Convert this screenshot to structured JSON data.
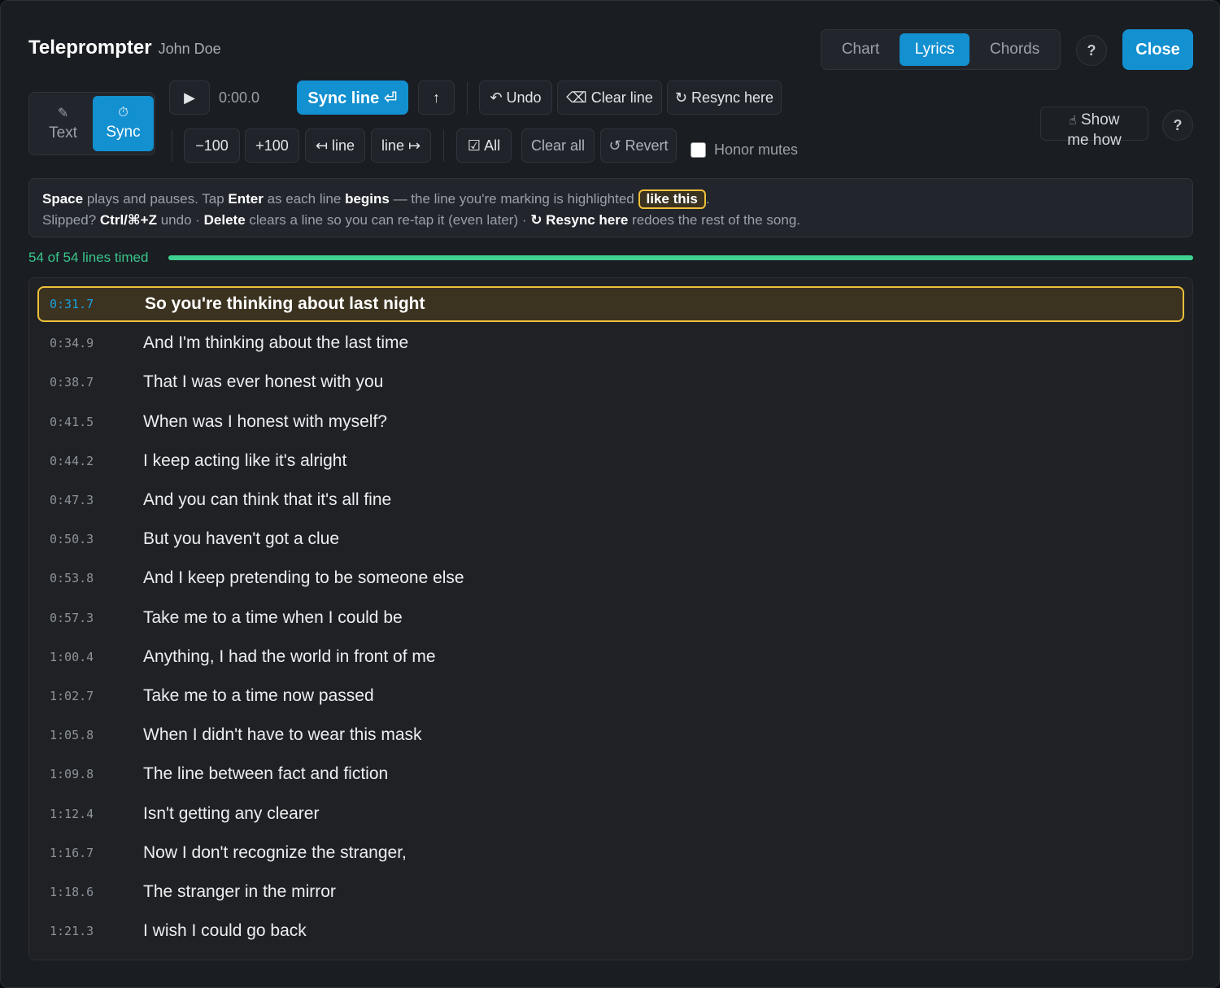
{
  "header": {
    "title": "Teleprompter",
    "artist": "John Doe",
    "tabs": [
      "Chart",
      "Lyrics",
      "Chords"
    ],
    "active_tab": "Lyrics",
    "help_label": "?",
    "close_label": "Close"
  },
  "mode": {
    "text_label": "Text",
    "sync_label": "Sync",
    "active": "Sync"
  },
  "toolbar": {
    "play_icon": "▶",
    "time": "0:00.0",
    "sync_line_label": "Sync line ⏎",
    "up_label": "↑",
    "undo_label": "↶ Undo",
    "clear_line_label": "⌫ Clear line",
    "resync_label": "↻ Resync here",
    "minus100_label": "−100",
    "plus100_label": "+100",
    "left_line_label": "↤ line",
    "right_line_label": "line ↦",
    "all_label": "☑ All",
    "clear_all_label": "Clear all",
    "revert_label": "↺ Revert",
    "honor_mutes_label": "Honor mutes",
    "honor_mutes_checked": false,
    "show_me_line1": "Show",
    "show_me_line2": "me how"
  },
  "hint": {
    "l1_k1": "Space",
    "l1_t1": " plays and pauses. Tap ",
    "l1_k2": "Enter",
    "l1_t2": " as each line ",
    "l1_k3": "begins",
    "l1_t3": " — the line you're marking is highlighted ",
    "l1_hl": "like this",
    "l1_t4": ".",
    "l2_t1": "Slipped? ",
    "l2_k1": "Ctrl/⌘+Z",
    "l2_t2": " undo · ",
    "l2_k2": "Delete",
    "l2_t3": " clears a line so you can re-tap it (even later) · ",
    "l2_k3": "↻ Resync here",
    "l2_t4": " redoes the rest of the song."
  },
  "progress": {
    "label": "54 of 54 lines timed",
    "fraction": 1.0
  },
  "lines": [
    {
      "time": "0:31.7",
      "text": "So you're thinking about last night",
      "active": true
    },
    {
      "time": "0:34.9",
      "text": "And I'm thinking about the last time"
    },
    {
      "time": "0:38.7",
      "text": "That I was ever honest with you"
    },
    {
      "time": "0:41.5",
      "text": "When was I honest with myself?"
    },
    {
      "time": "0:44.2",
      "text": "I keep acting like it's alright"
    },
    {
      "time": "0:47.3",
      "text": "And you can think that it's all fine"
    },
    {
      "time": "0:50.3",
      "text": "But you haven't got a clue"
    },
    {
      "time": "0:53.8",
      "text": "And I keep pretending to be someone else"
    },
    {
      "time": "0:57.3",
      "text": "Take me to a time when I could be"
    },
    {
      "time": "1:00.4",
      "text": "Anything, I had the world in front of me"
    },
    {
      "time": "1:02.7",
      "text": "Take me to a time now passed"
    },
    {
      "time": "1:05.8",
      "text": "When I didn't have to wear this mask"
    },
    {
      "time": "1:09.8",
      "text": "The line between fact and fiction"
    },
    {
      "time": "1:12.4",
      "text": "Isn't getting any clearer"
    },
    {
      "time": "1:16.7",
      "text": "Now I don't recognize the stranger,"
    },
    {
      "time": "1:18.6",
      "text": "The stranger in the mirror"
    },
    {
      "time": "1:21.3",
      "text": "I wish I could go back"
    }
  ],
  "colors": {
    "accent": "#1390d0",
    "highlight_border": "#f0c03a",
    "progress": "#3fd192"
  }
}
